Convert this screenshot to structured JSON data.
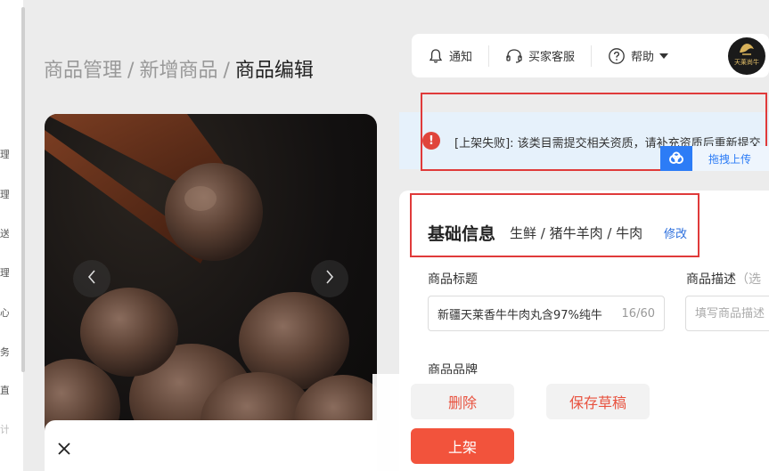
{
  "sidebar": {
    "chars": [
      "理",
      "理",
      "送",
      "理",
      "心",
      "务",
      "直",
      "计"
    ]
  },
  "breadcrumb": {
    "items": [
      "商品管理",
      "新增商品"
    ],
    "separator": "/",
    "current": "商品编辑"
  },
  "topbar": {
    "notify_label": "通知",
    "service_label": "买家客服",
    "help_label": "帮助",
    "avatar_text": "天莱尚牛"
  },
  "alert": {
    "message": "[上架失败]: 该类目需提交相关资质，请补充资质后重新提交",
    "upload_label": "拖拽上传",
    "color": "#e0453b"
  },
  "form": {
    "section_title": "基础信息",
    "category_path": "生鲜 / 猪牛羊肉 / 牛肉",
    "modify_label": "修改",
    "title_label": "商品标题",
    "title_value": "新疆天莱香牛牛肉丸含97%纯牛",
    "title_counter": "16/60",
    "desc_label": "商品描述",
    "desc_optional": "（选",
    "desc_placeholder": "填写商品描述",
    "brand_label": "商品品牌"
  },
  "actions": {
    "delete_label": "删除",
    "draft_label": "保存草稿",
    "publish_label": "上架",
    "accent_color": "#f2533c"
  }
}
